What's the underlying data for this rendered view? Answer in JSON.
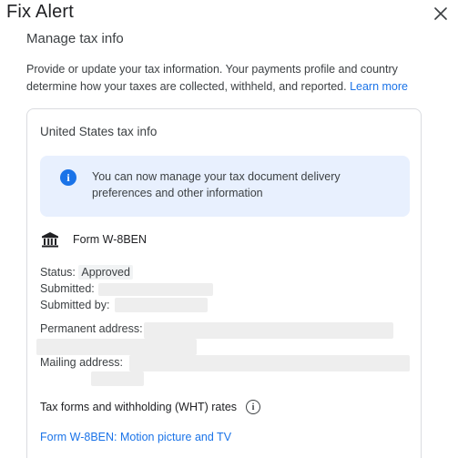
{
  "dialog": {
    "title": "Fix Alert",
    "close_icon": "close-icon"
  },
  "section": {
    "heading": "Manage tax info",
    "intro_text": "Provide or update your tax information. Your payments profile and country determine how your taxes are collected, withheld, and reported. ",
    "learn_more": "Learn more"
  },
  "card": {
    "title": "United States tax info",
    "notice": {
      "icon": "info-icon",
      "text": "You can now manage your tax document delivery preferences and other information"
    },
    "form": {
      "icon": "bank-icon",
      "name": "Form W-8BEN"
    },
    "status_label": "Status:",
    "status_value": "Approved",
    "submitted_label": "Submitted:",
    "submitted_by_label": "Submitted by:",
    "permanent_address_label": "Permanent address:",
    "mailing_address_label": "Mailing address:",
    "wht_heading": "Tax forms and withholding (WHT) rates",
    "wht_info_icon": "info-outline-icon",
    "form_link": "Form W-8BEN: Motion picture and TV"
  }
}
